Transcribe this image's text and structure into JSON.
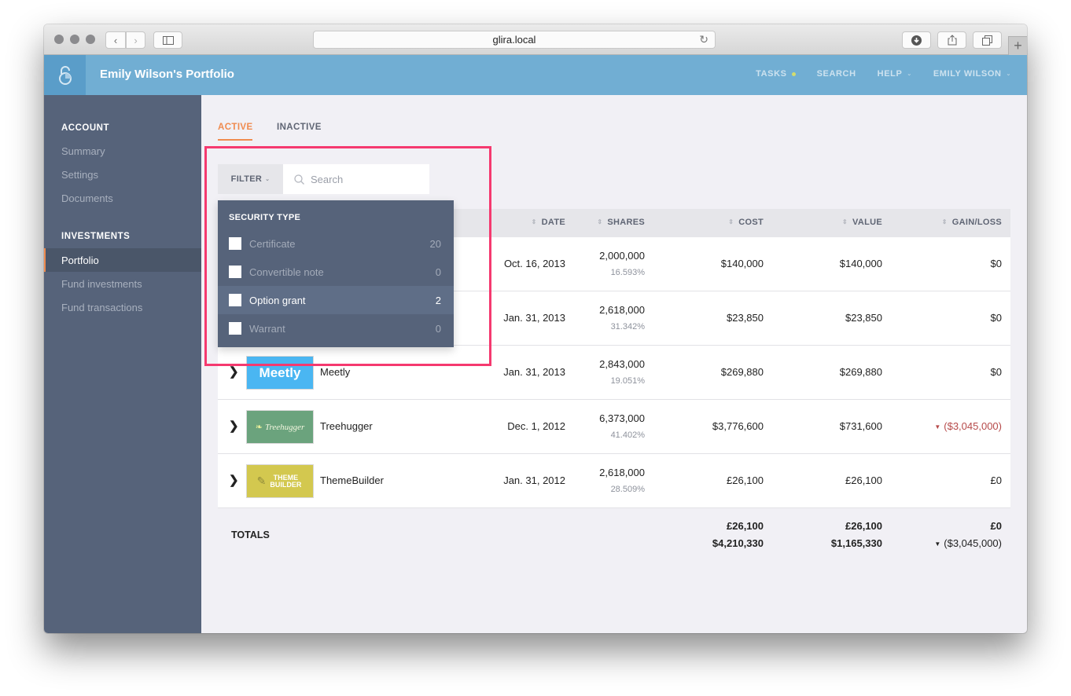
{
  "browser": {
    "url": "glira.local",
    "new_tab_label": "+"
  },
  "header": {
    "title": "Emily Wilson's Portfolio",
    "nav": [
      {
        "label": "TASKS",
        "indicator": "dot",
        "indicator_color": "#d3dc6e"
      },
      {
        "label": "SEARCH"
      },
      {
        "label": "HELP",
        "dropdown": true
      },
      {
        "label": "EMILY WILSON",
        "dropdown": true
      }
    ],
    "brand_color": "#71aed3"
  },
  "sidebar": {
    "sections": [
      {
        "title": "ACCOUNT",
        "items": [
          {
            "label": "Summary"
          },
          {
            "label": "Settings"
          },
          {
            "label": "Documents"
          }
        ]
      },
      {
        "title": "INVESTMENTS",
        "items": [
          {
            "label": "Portfolio",
            "active": true
          },
          {
            "label": "Fund investments"
          },
          {
            "label": "Fund transactions"
          }
        ]
      }
    ]
  },
  "tabs": [
    {
      "label": "ACTIVE",
      "active": true
    },
    {
      "label": "INACTIVE",
      "active": false
    }
  ],
  "filter": {
    "button_label": "FILTER",
    "search_placeholder": "Search",
    "search_value": "",
    "dropdown": {
      "heading": "SECURITY TYPE",
      "options": [
        {
          "label": "Certificate",
          "count": "20",
          "checked": false
        },
        {
          "label": "Convertible note",
          "count": "0",
          "checked": false
        },
        {
          "label": "Option grant",
          "count": "2",
          "checked": false,
          "highlighted": true
        },
        {
          "label": "Warrant",
          "count": "0",
          "checked": false
        }
      ]
    }
  },
  "table": {
    "columns": [
      "DATE",
      "SHARES",
      "COST",
      "VALUE",
      "GAIN/LOSS"
    ],
    "rows": [
      {
        "company": "",
        "logo_text": "",
        "date": "Oct. 16, 2013",
        "shares": "2,000,000",
        "pct": "16.593%",
        "cost": "$140,000",
        "value": "$140,000",
        "gain": "$0",
        "loss": false
      },
      {
        "company": "",
        "logo_text": "",
        "date": "Jan. 31, 2013",
        "shares": "2,618,000",
        "pct": "31.342%",
        "cost": "$23,850",
        "value": "$23,850",
        "gain": "$0",
        "loss": false
      },
      {
        "company": "Meetly",
        "logo_text": "Meetly",
        "logo_color": "#4ab6f2",
        "date": "Jan. 31, 2013",
        "shares": "2,843,000",
        "pct": "19.051%",
        "cost": "$269,880",
        "value": "$269,880",
        "gain": "$0",
        "loss": false
      },
      {
        "company": "Treehugger",
        "logo_text": "Treehugger",
        "logo_color": "#6ba37d",
        "date": "Dec. 1, 2012",
        "shares": "6,373,000",
        "pct": "41.402%",
        "cost": "$3,776,600",
        "value": "$731,600",
        "gain": "($3,045,000)",
        "loss": true
      },
      {
        "company": "ThemeBuilder",
        "logo_text": "THEME BUILDER",
        "logo_color": "#d3c84f",
        "date": "Jan. 31, 2012",
        "shares": "2,618,000",
        "pct": "28.509%",
        "cost": "£26,100",
        "value": "£26,100",
        "gain": "£0",
        "loss": false
      }
    ],
    "totals": {
      "label": "TOTALS",
      "cost": [
        "£26,100",
        "$4,210,330"
      ],
      "value": [
        "£26,100",
        "$1,165,330"
      ],
      "gain": [
        "£0",
        "($3,045,000)"
      ]
    }
  },
  "colors": {
    "accent": "#f08b4f",
    "sidebar": "#56637a",
    "loss": "#b64a4a",
    "annotation": "#f5396f"
  }
}
